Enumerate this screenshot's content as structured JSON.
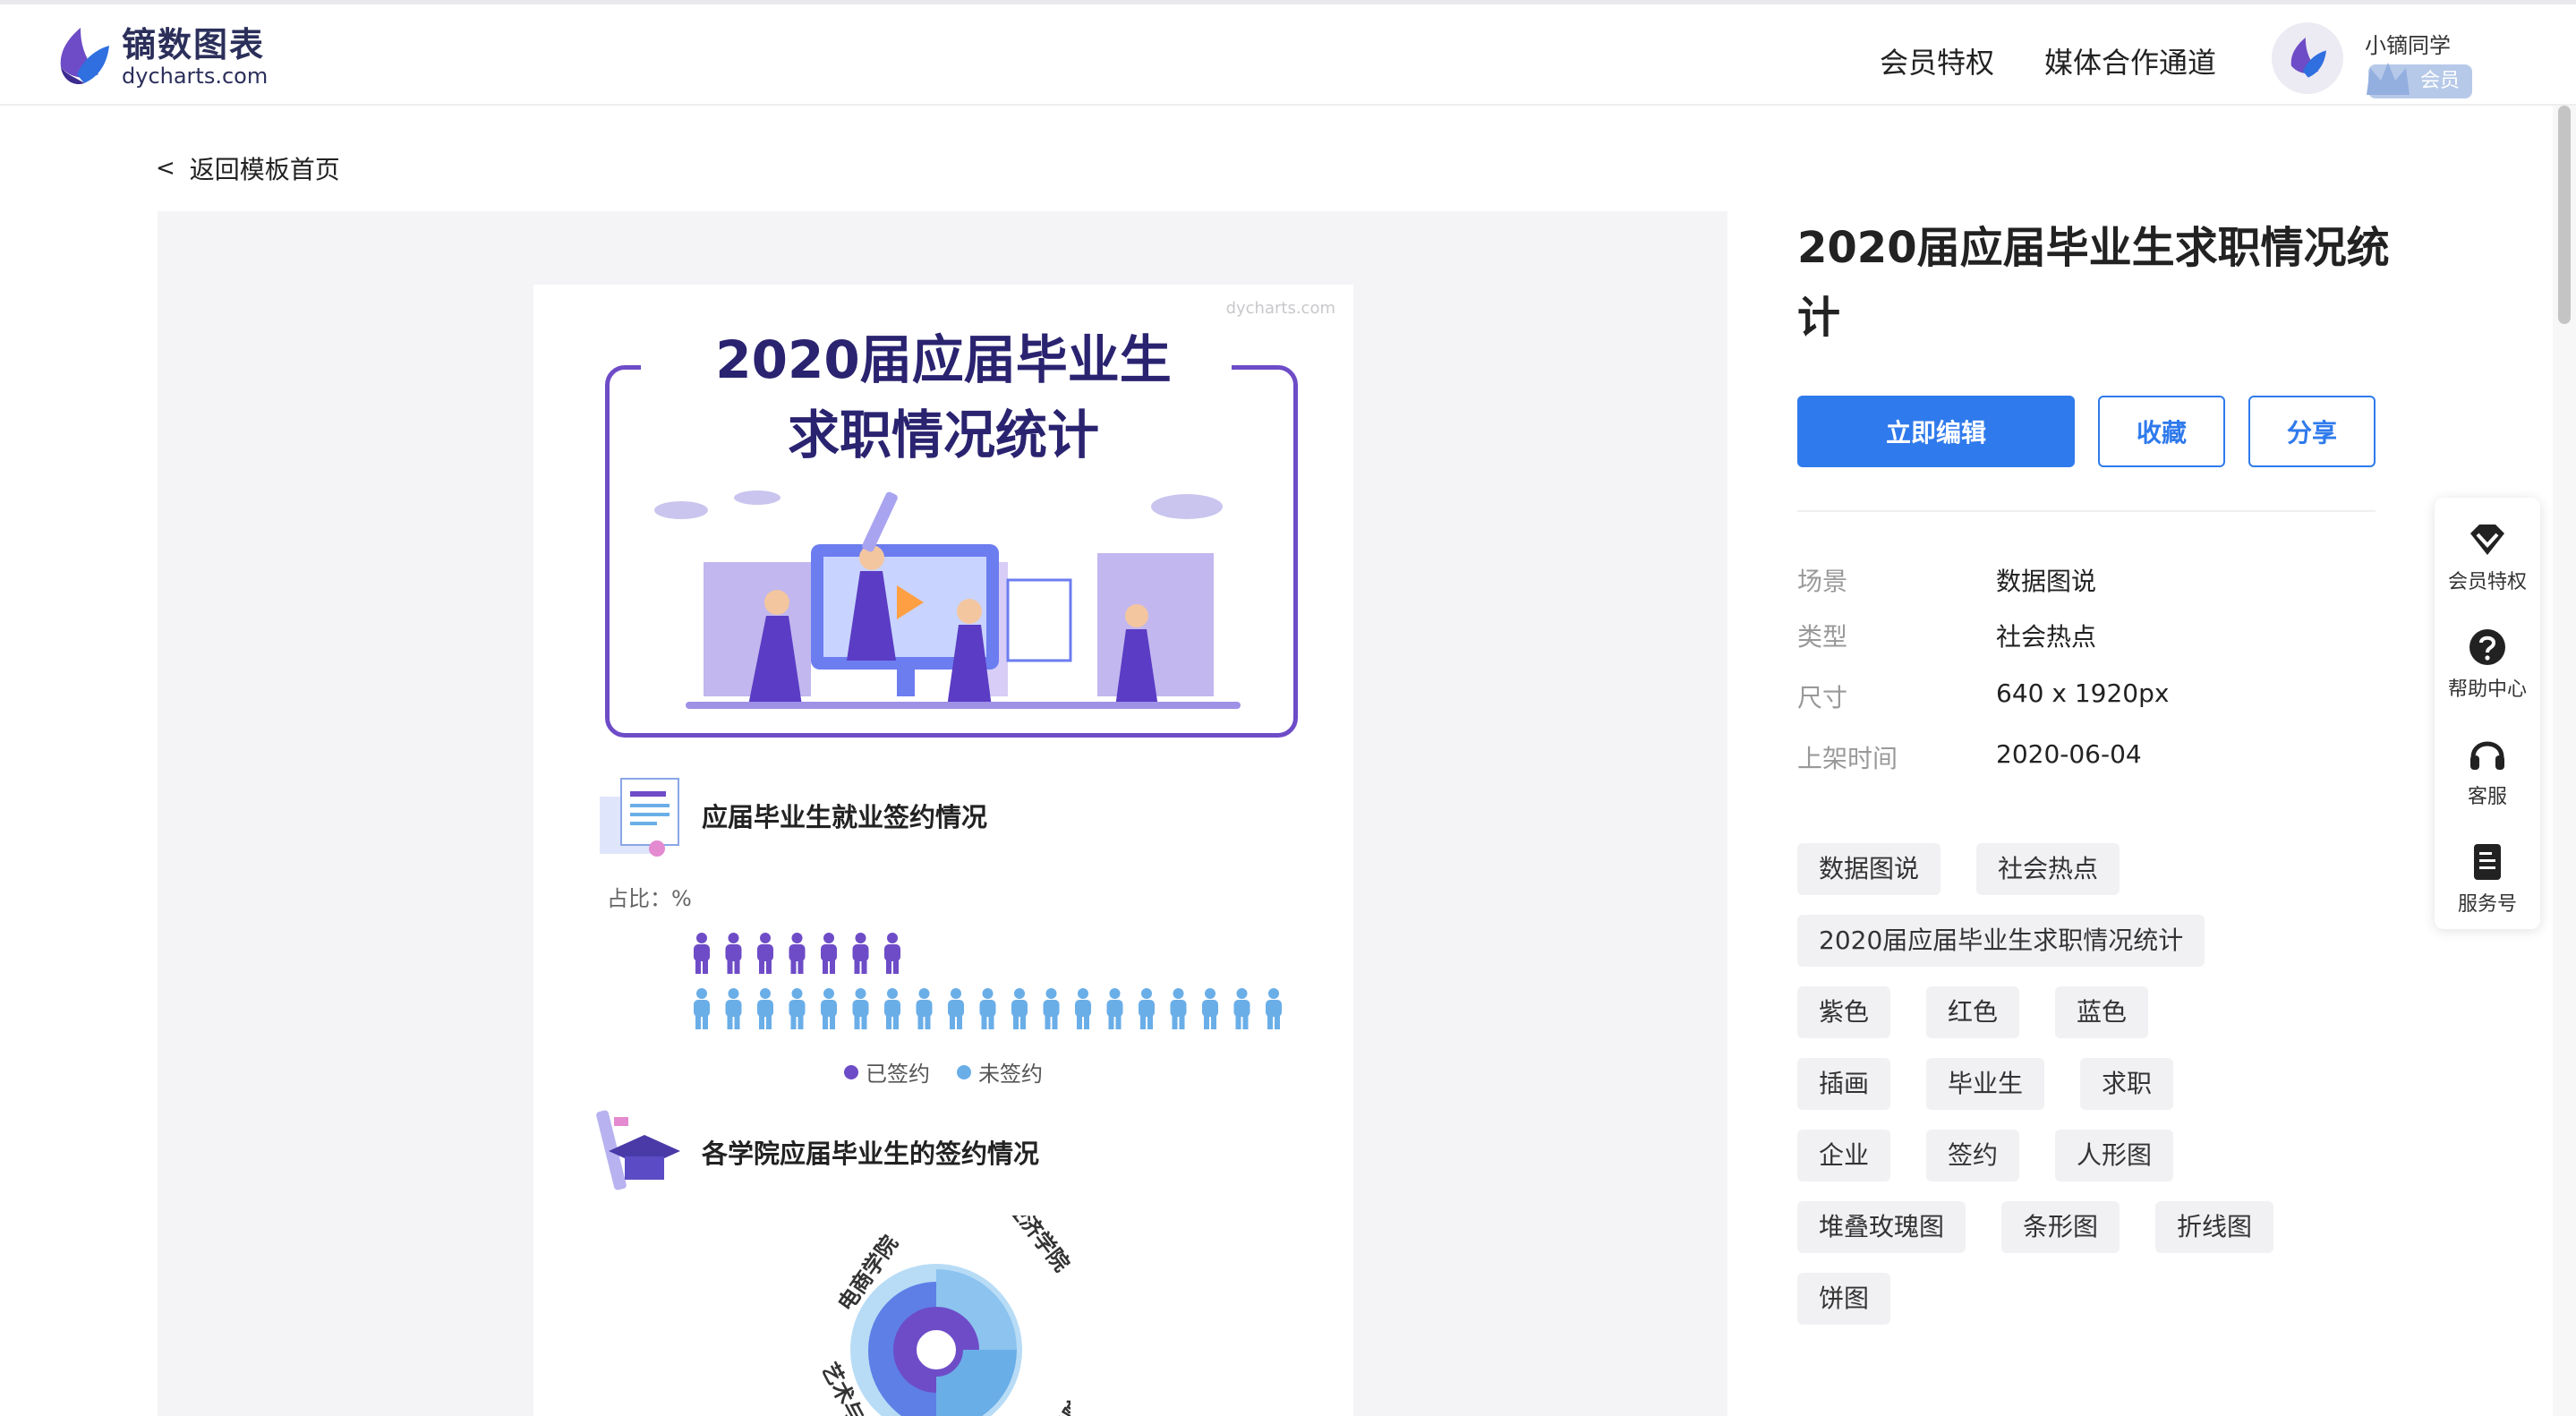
{
  "header": {
    "logo_name": "镝数图表",
    "logo_url": "dycharts.com",
    "nav": [
      "会员特权",
      "媒体合作通道"
    ],
    "user_name": "小镝同学",
    "vip_label": "会员"
  },
  "back_link": "返回模板首页",
  "poster": {
    "watermark": "dycharts.com",
    "title_line1": "2020届应届毕业生",
    "title_line2": "求职情况统计",
    "section1_title": "应届毕业生就业签约情况",
    "ratio_label": "占比：%",
    "legend": [
      "已签约",
      "未签约"
    ],
    "section2_title": "各学院应届毕业生的签约情况",
    "rose_labels": [
      "电商学院",
      "经济学院",
      "艺术与传媒",
      "管理学院"
    ]
  },
  "template": {
    "title": "2020届应届毕业生求职情况统计",
    "buttons": {
      "edit": "立即编辑",
      "favorite": "收藏",
      "share": "分享"
    },
    "meta": [
      {
        "key": "场景",
        "value": "数据图说"
      },
      {
        "key": "类型",
        "value": "社会热点"
      },
      {
        "key": "尺寸",
        "value": "640 x 1920px"
      },
      {
        "key": "上架时间",
        "value": "2020-06-04"
      }
    ],
    "tags": [
      "数据图说",
      "社会热点",
      "2020届应届毕业生求职情况统计",
      "紫色",
      "红色",
      "蓝色",
      "插画",
      "毕业生",
      "求职",
      "企业",
      "签约",
      "人形图",
      "堆叠玫瑰图",
      "条形图",
      "折线图",
      "饼图"
    ]
  },
  "float_bar": [
    "会员特权",
    "帮助中心",
    "客服",
    "服务号"
  ],
  "colors": {
    "accent": "#2f7aec",
    "purple": "#6e4cc7",
    "blue": "#6aaee8",
    "navy": "#2a2370"
  }
}
